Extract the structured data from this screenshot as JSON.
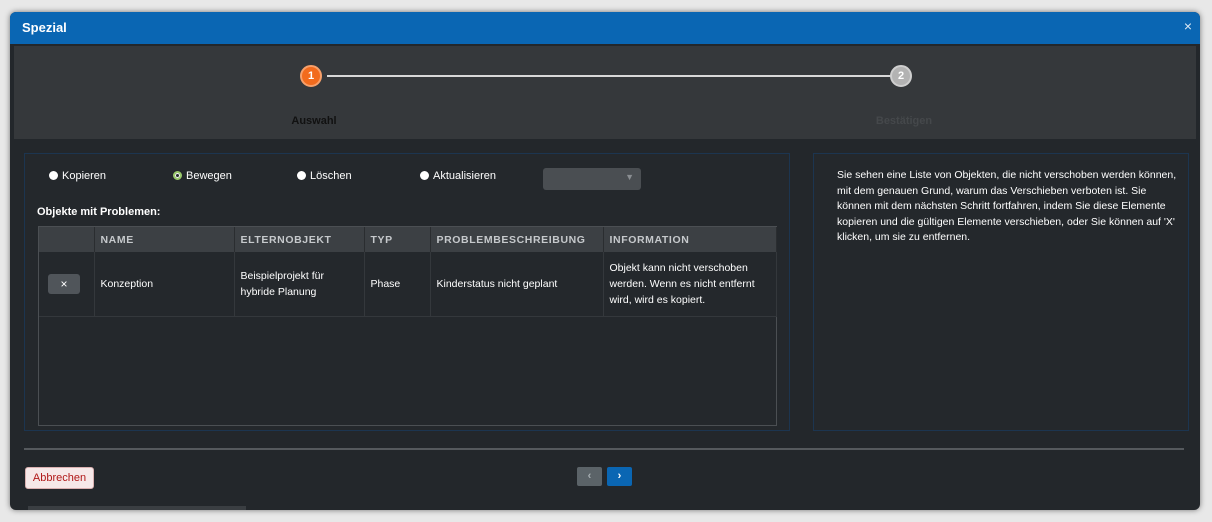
{
  "dialog": {
    "title": "Spezial",
    "close_icon": "×"
  },
  "wizard": {
    "steps": [
      {
        "number": "1",
        "label": "Auswahl",
        "active": true
      },
      {
        "number": "2",
        "label": "Bestätigen",
        "active": false
      }
    ]
  },
  "options": {
    "radios": [
      {
        "label": "Kopieren",
        "checked": false
      },
      {
        "label": "Bewegen",
        "checked": true
      },
      {
        "label": "Löschen",
        "checked": false
      },
      {
        "label": "Aktualisieren",
        "checked": false
      }
    ],
    "select_value": ""
  },
  "problems": {
    "title": "Objekte mit Problemen:",
    "columns": [
      "",
      "NAME",
      "ELTERNOBJEKT",
      "TYP",
      "PROBLEMBESCHREIBUNG",
      "INFORMATION"
    ],
    "rows": [
      {
        "remove": "×",
        "name": "Konzeption",
        "parent": "Beispielprojekt für hybride Planung",
        "type": "Phase",
        "problem": "Kinderstatus nicht geplant",
        "info": "Objekt kann nicht verschoben werden. Wenn es nicht entfernt wird, wird es kopiert."
      }
    ]
  },
  "info_panel": {
    "text": "Sie sehen eine Liste von Objekten, die nicht verschoben werden können, mit dem genauen Grund, warum das Verschieben verboten ist. Sie können mit dem nächsten Schritt fortfahren, indem Sie diese Elemente kopieren und die gültigen Elemente verschieben, oder Sie können auf 'X' klicken, um sie zu entfernen."
  },
  "footer": {
    "cancel_label": "Abbrechen",
    "prev_label": "‹",
    "next_label": "›"
  },
  "colors": {
    "titlebar": "#0a66b3",
    "step_active": "#f26b1d",
    "step_inactive": "#b3b3b3",
    "radio_checked": "#9ac96c",
    "cancel_text": "#b01818"
  }
}
